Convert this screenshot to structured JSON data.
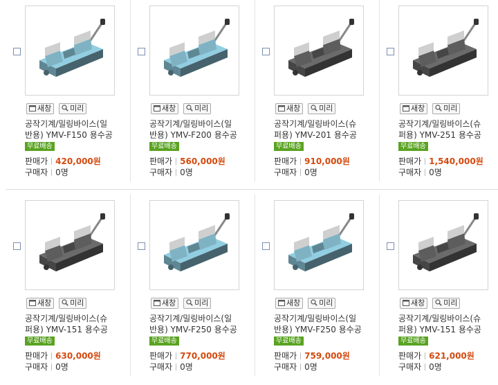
{
  "products": [
    {
      "new_window_label": "새창",
      "preview_label": "미리",
      "name_line1": "공작기계/밀링바이스(일",
      "name_line2": "반용) YMV-F150 용수공",
      "badge": "무료배송",
      "price_label": "판매가",
      "price": "420,000원",
      "buyers_label": "구매자",
      "buyers": "0명",
      "color": "#7fb3c4"
    },
    {
      "new_window_label": "새창",
      "preview_label": "미리",
      "name_line1": "공작기계/밀링바이스(일",
      "name_line2": "반용) YMV-F200 용수공",
      "badge": "무료배송",
      "price_label": "판매가",
      "price": "560,000원",
      "buyers_label": "구매자",
      "buyers": "0명",
      "color": "#7fb3c4"
    },
    {
      "new_window_label": "새창",
      "preview_label": "미리",
      "name_line1": "공작기계/밀링바이스(슈",
      "name_line2": "퍼용) YMV-201 용수공",
      "badge": "무료배송",
      "price_label": "판매가",
      "price": "910,000원",
      "buyers_label": "구매자",
      "buyers": "0명",
      "color": "#5d5d5d"
    },
    {
      "new_window_label": "새창",
      "preview_label": "미리",
      "name_line1": "공작기계/밀링바이스(슈",
      "name_line2": "퍼용) YMV-251 용수공",
      "badge": "무료배송",
      "price_label": "판매가",
      "price": "1,540,000원",
      "buyers_label": "구매자",
      "buyers": "0명",
      "color": "#5d5d5d"
    },
    {
      "new_window_label": "새창",
      "preview_label": "미리",
      "name_line1": "공작기계/밀링바이스(슈",
      "name_line2": "퍼용) YMV-151 용수공",
      "badge": "무료배송",
      "price_label": "판매가",
      "price": "630,000원",
      "buyers_label": "구매자",
      "buyers": "0명",
      "color": "#5d5d5d"
    },
    {
      "new_window_label": "새창",
      "preview_label": "미리",
      "name_line1": "공작기계/밀링바이스(일",
      "name_line2": "반용) YMV-F250 용수공",
      "badge": "무료배송",
      "price_label": "판매가",
      "price": "770,000원",
      "buyers_label": "구매자",
      "buyers": "0명",
      "color": "#7fb3c4"
    },
    {
      "new_window_label": "새창",
      "preview_label": "미리",
      "name_line1": "공작기계/밀링바이스(일",
      "name_line2": "반용) YMV-F250 용수공",
      "badge": "무료배송",
      "price_label": "판매가",
      "price": "759,000원",
      "buyers_label": "구매자",
      "buyers": "0명",
      "color": "#7fb3c4"
    },
    {
      "new_window_label": "새창",
      "preview_label": "미리",
      "name_line1": "공작기계/밀링바이스(슈",
      "name_line2": "퍼용) YMV-151 용수공",
      "badge": "무료배송",
      "price_label": "판매가",
      "price": "621,000원",
      "buyers_label": "구매자",
      "buyers": "0명",
      "color": "#5d5d5d"
    }
  ],
  "colors": {
    "price": "#d44a0e",
    "badge": "#5aa322"
  },
  "icons": {
    "new_window": "window-icon",
    "preview": "magnifier-icon",
    "product": "milling-vise-image"
  }
}
